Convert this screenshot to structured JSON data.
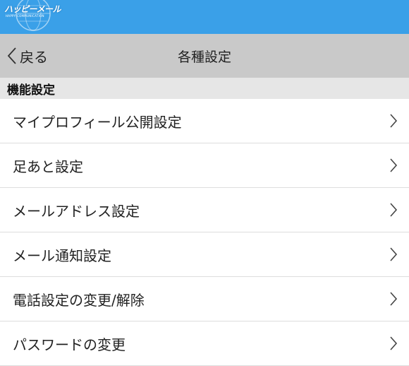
{
  "header": {
    "logo_text": "ハッピーメール",
    "logo_subtext": "HAPPY COMMUNICATION",
    "logo_icon": "globe-icon",
    "bg_color": "#3aa0e8"
  },
  "nav": {
    "back_label": "戻る",
    "back_icon": "chevron-left-icon",
    "title": "各種設定",
    "bg_color": "#c9c9c9"
  },
  "section": {
    "title": "機能設定"
  },
  "items": [
    {
      "label": "マイプロフィール公開設定",
      "icon": "chevron-right-icon"
    },
    {
      "label": "足あと設定",
      "icon": "chevron-right-icon"
    },
    {
      "label": "メールアドレス設定",
      "icon": "chevron-right-icon"
    },
    {
      "label": "メール通知設定",
      "icon": "chevron-right-icon"
    },
    {
      "label": "電話設定の変更/解除",
      "icon": "chevron-right-icon"
    },
    {
      "label": "パスワードの変更",
      "icon": "chevron-right-icon"
    }
  ]
}
